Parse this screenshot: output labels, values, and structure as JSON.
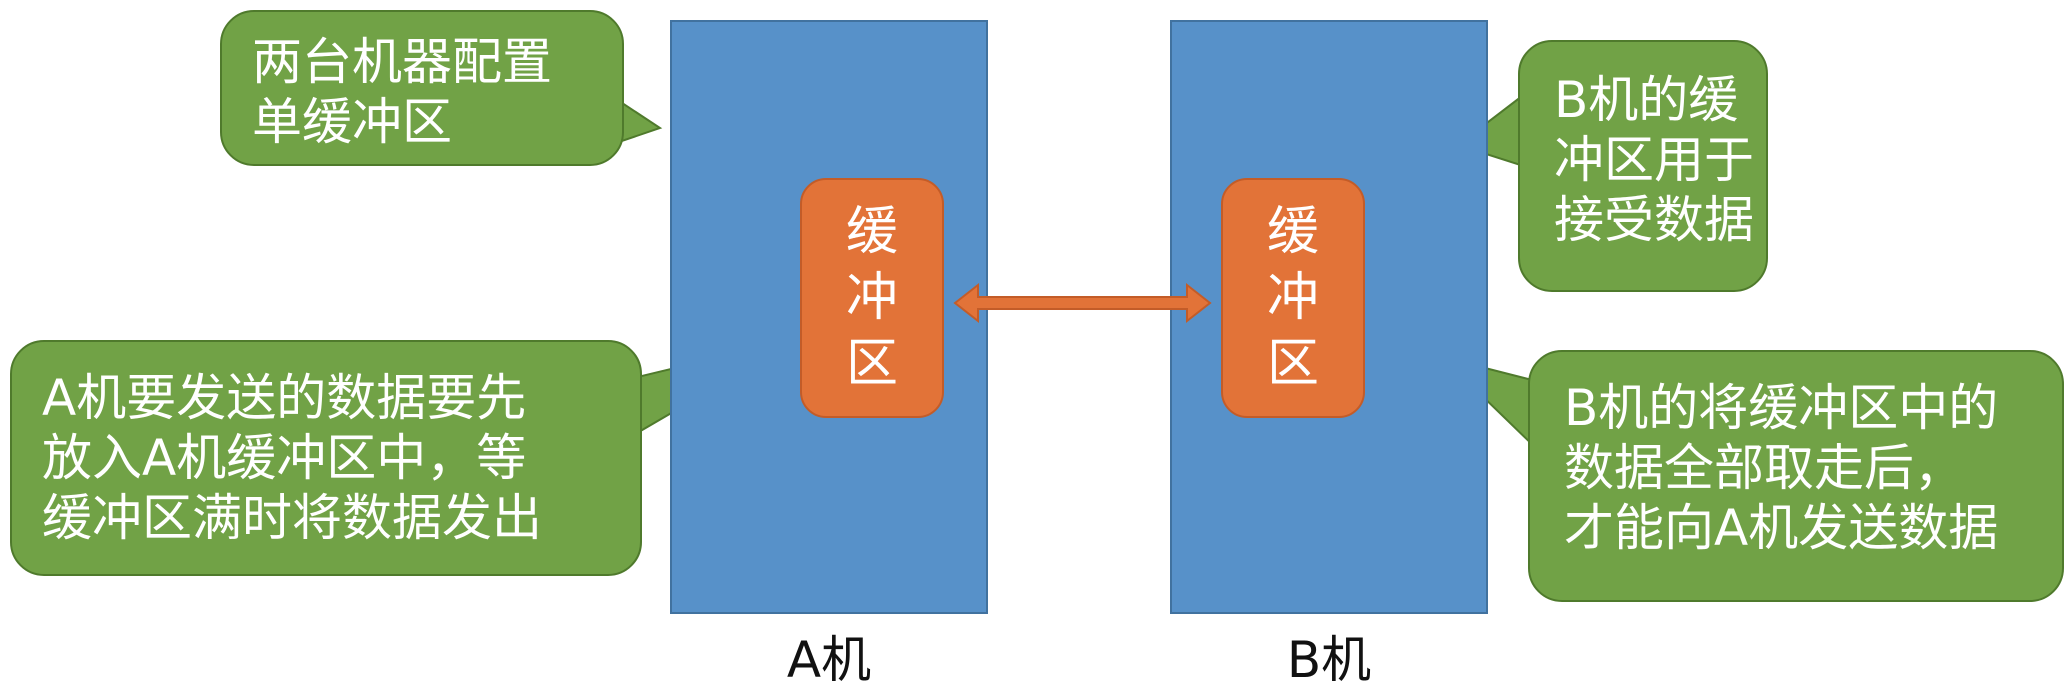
{
  "colors": {
    "machine_fill": "#5791c9",
    "buffer_fill": "#e27338",
    "callout_fill": "#71a246",
    "text_on_shape": "#ffffff",
    "label_text": "#111111"
  },
  "machines": {
    "a": {
      "label": "A机",
      "buffer_chars": [
        "缓",
        "冲",
        "区"
      ]
    },
    "b": {
      "label": "B机",
      "buffer_chars": [
        "缓",
        "冲",
        "区"
      ]
    }
  },
  "callouts": {
    "dual_single_buffer": {
      "lines": [
        "两台机器配置",
        "单缓冲区"
      ]
    },
    "b_receive": {
      "lines": [
        "B机的缓",
        "冲区用于",
        "接受数据"
      ]
    },
    "a_send": {
      "lines": [
        "A机要发送的数据要先",
        "放入A机缓冲区中，等",
        "缓冲区满时将数据发出"
      ]
    },
    "b_takeout": {
      "lines": [
        "B机的将缓冲区中的",
        "数据全部取走后，",
        "才能向A机发送数据"
      ]
    }
  }
}
